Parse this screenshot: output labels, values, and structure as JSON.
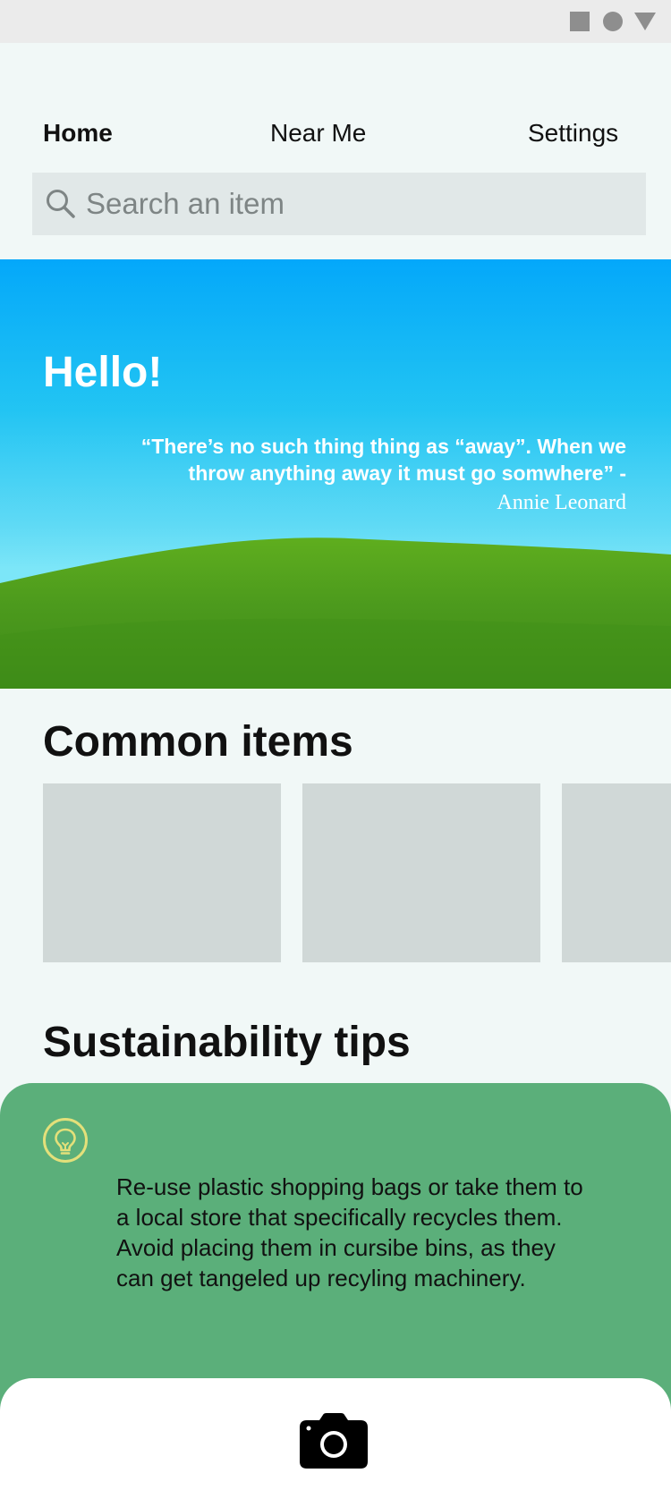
{
  "status_bar": {
    "icons": [
      "square-icon",
      "circle-icon",
      "triangle-icon"
    ]
  },
  "nav": {
    "home": "Home",
    "near_me": "Near Me",
    "settings": "Settings"
  },
  "search": {
    "placeholder": "Search an item",
    "icon": "search-icon"
  },
  "hero": {
    "title": "Hello!",
    "quote": "“There’s no such thing thing as “away”. When we throw anything away it must go somwhere” -",
    "author": "Annie Leonard"
  },
  "common_items": {
    "title": "Common items"
  },
  "tips": {
    "title": "Sustainability tips",
    "icon": "lightbulb-icon",
    "text": "Re-use plastic shopping bags or take them to a local store that specifically recycles them. Avoid placing them in cursibe bins, as they can get tangeled up recyling machinery."
  },
  "bottom_bar": {
    "icon": "camera-icon"
  },
  "colors": {
    "background": "#F1F8F7",
    "tip_card": "#5BAF7A",
    "search_bg": "#E1E8E8",
    "card_placeholder": "#D0D8D7",
    "bulb": "#E3E07A"
  }
}
